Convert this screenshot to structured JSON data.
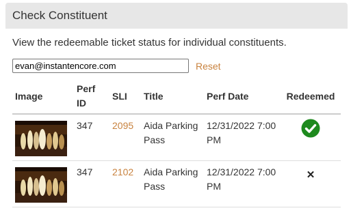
{
  "panel": {
    "title": "Check Constituent",
    "description": "View the redeemable ticket status for individual constituents."
  },
  "search": {
    "value": "evan@instantencore.com",
    "reset_label": "Reset"
  },
  "table": {
    "headers": {
      "image": "Image",
      "perf_id": "Perf ID",
      "sli": "SLI",
      "title": "Title",
      "perf_date": "Perf Date",
      "redeemed": "Redeemed"
    },
    "rows": [
      {
        "image_icon": "opera-performance-thumbnail",
        "perf_id": "347",
        "sli": "2095",
        "title": "Aida Parking Pass",
        "perf_date": "12/31/2022 7:00 PM",
        "redeemed": true,
        "redeemed_icon": "check-circle-icon"
      },
      {
        "image_icon": "opera-performance-thumbnail",
        "perf_id": "347",
        "sli": "2102",
        "title": "Aida Parking Pass",
        "perf_date": "12/31/2022 7:00 PM",
        "redeemed": false,
        "redeemed_icon": "x-mark-icon",
        "redeemed_glyph": "✕"
      }
    ]
  },
  "colors": {
    "link": "#c8823e",
    "heading_bg": "#e7e7e7",
    "check_green": "#1e8a1e"
  }
}
